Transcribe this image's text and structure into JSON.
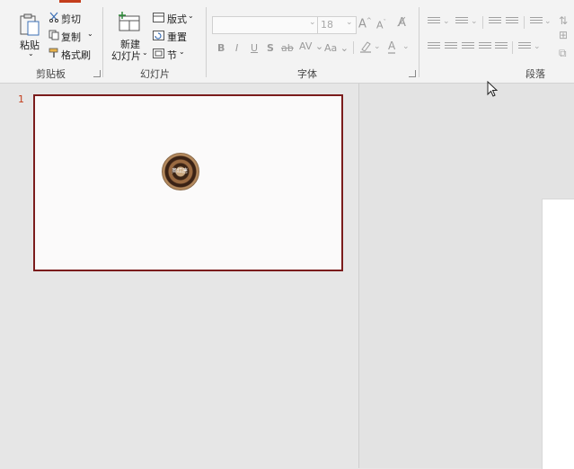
{
  "clipboard": {
    "paste_label": "粘贴",
    "cut_label": "剪切",
    "copy_label": "复制",
    "format_painter_label": "格式刷",
    "group_label": "剪贴板"
  },
  "slides": {
    "new_slide_line1": "新建",
    "new_slide_line2": "幻灯片",
    "layout_label": "版式",
    "reset_label": "重置",
    "section_label": "节",
    "group_label": "幻灯片"
  },
  "font": {
    "size_value": "18",
    "bold": "B",
    "italic": "I",
    "underline": "U",
    "shadow": "S",
    "strikethrough": "ab",
    "spacing": "AV",
    "case": "Aa",
    "color": "A",
    "grow": "A",
    "shrink": "A",
    "group_label": "字体"
  },
  "paragraph": {
    "group_label": "段落"
  },
  "thumbnail_pane": {
    "slide_number": "1",
    "image_text": "奥红唐"
  },
  "colors": {
    "accent": "#c43e1c",
    "selection_border": "#7b1c1c"
  }
}
